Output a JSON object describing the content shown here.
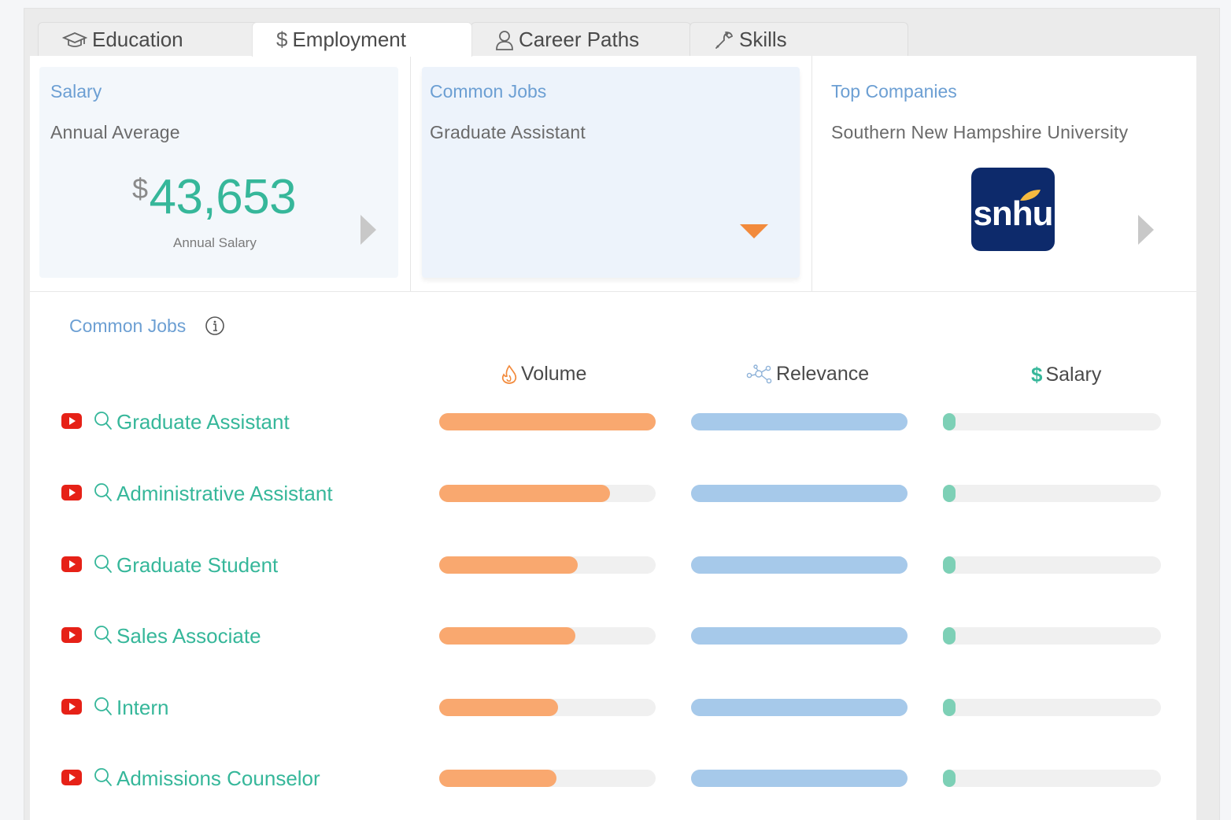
{
  "tabs": [
    {
      "label": "Education",
      "icon": "graduation-cap-icon"
    },
    {
      "label": "Employment",
      "icon": "dollar-icon"
    },
    {
      "label": "Career Paths",
      "icon": "person-icon"
    },
    {
      "label": "Skills",
      "icon": "wrench-icon"
    }
  ],
  "active_tab": "Employment",
  "salary_card": {
    "title": "Salary",
    "subtitle": "Annual Average",
    "currency": "$",
    "amount": "43,653",
    "caption": "Annual Salary"
  },
  "jobs_card": {
    "title": "Common Jobs",
    "subtitle": "Graduate Assistant"
  },
  "companies_card": {
    "title": "Top Companies",
    "subtitle": "Southern New Hampshire University",
    "logo_text": "snhu"
  },
  "section": {
    "title": "Common Jobs"
  },
  "columns": {
    "volume": "Volume",
    "relevance": "Relevance",
    "salary": "Salary"
  },
  "colors": {
    "volume": "#f9a86f",
    "relevance": "#a6c9ea",
    "salary": "#7dd0b6",
    "accent_green": "#36b79a",
    "accent_blue": "#6c9fd3"
  },
  "jobs": [
    {
      "label": "Graduate Assistant",
      "volume": 1.0,
      "relevance": 1.0,
      "salary": 0.05
    },
    {
      "label": "Administrative Assistant",
      "volume": 0.79,
      "relevance": 1.0,
      "salary": 0.05
    },
    {
      "label": "Graduate Student",
      "volume": 0.64,
      "relevance": 1.0,
      "salary": 0.05
    },
    {
      "label": "Sales Associate",
      "volume": 0.63,
      "relevance": 1.0,
      "salary": 0.05
    },
    {
      "label": "Intern",
      "volume": 0.55,
      "relevance": 1.0,
      "salary": 0.05
    },
    {
      "label": "Admissions Counselor",
      "volume": 0.54,
      "relevance": 1.0,
      "salary": 0.05
    }
  ]
}
